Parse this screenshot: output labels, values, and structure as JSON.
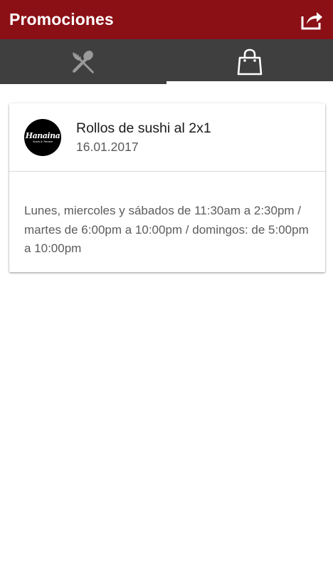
{
  "appbar": {
    "title": "Promociones",
    "share_icon": "share-icon",
    "background": "#8b1016"
  },
  "tabs": [
    {
      "icon": "fork-spoon-icon",
      "active": false
    },
    {
      "icon": "shopping-bag-icon",
      "active": true
    }
  ],
  "promotion": {
    "logo_text": "Hanaina",
    "logo_subtext": "Sushi & Terrace",
    "title": "Rollos de sushi al 2x1",
    "date": "16.01.2017",
    "description": "Lunes, miercoles y sábados de 11:30am a 2:30pm / martes de 6:00pm a 10:00pm / domingos: de 5:00pm a 10:00pm"
  }
}
